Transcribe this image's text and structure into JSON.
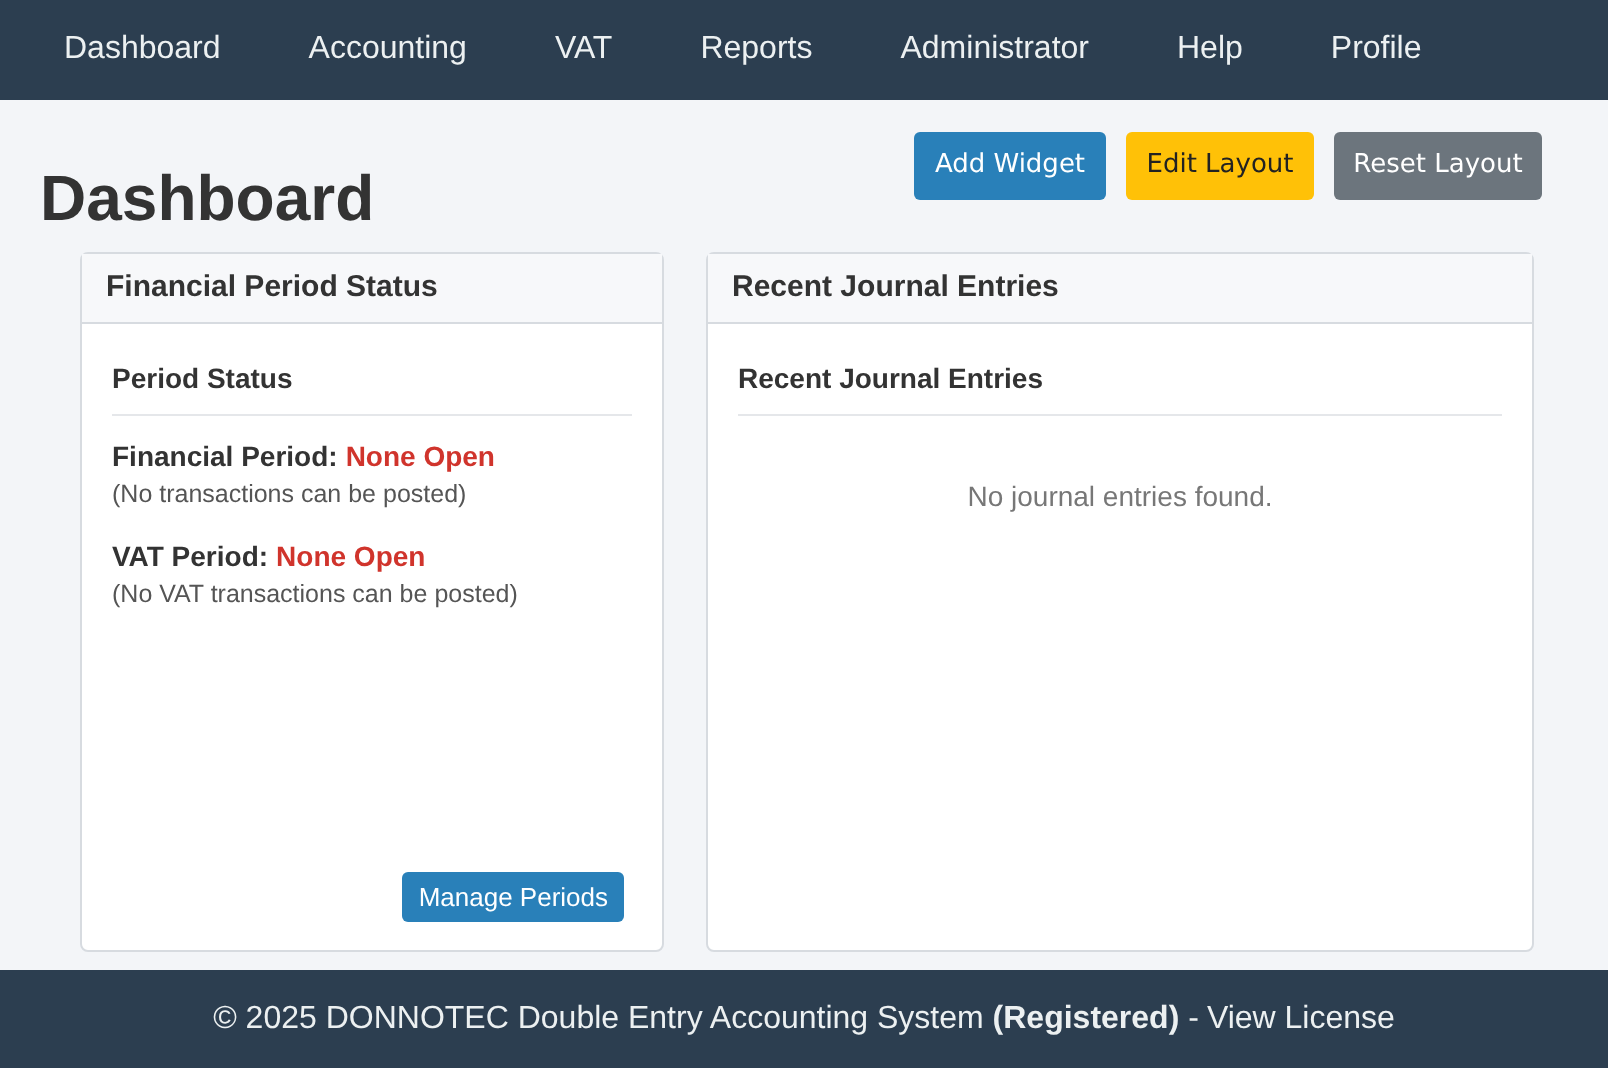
{
  "nav": [
    {
      "label": "Dashboard"
    },
    {
      "label": "Accounting"
    },
    {
      "label": "VAT"
    },
    {
      "label": "Reports"
    },
    {
      "label": "Administrator"
    },
    {
      "label": "Help"
    },
    {
      "label": "Profile"
    }
  ],
  "page_title": "Dashboard",
  "toolbar": [
    {
      "label": "Add Widget",
      "kind": "primary"
    },
    {
      "label": "Edit Layout",
      "kind": "warning"
    },
    {
      "label": "Reset Layout",
      "kind": "secondary"
    }
  ],
  "period_card": {
    "title": "Financial Period Status",
    "section_title": "Period Status",
    "statuses": [
      {
        "label": "Financial Period:",
        "value": "None Open",
        "note": "(No transactions can be posted)"
      },
      {
        "label": "VAT Period:",
        "value": "None Open",
        "note": "(No VAT transactions can be posted)"
      }
    ],
    "button": "Manage Periods"
  },
  "journal_card": {
    "title": "Recent Journal Entries",
    "section_title": "Recent Journal Entries",
    "empty_message": "No journal entries found."
  },
  "footer": {
    "text": "© 2025 DONNOTEC Double Entry Accounting System **(Registered)** -",
    "link": "View License"
  }
}
